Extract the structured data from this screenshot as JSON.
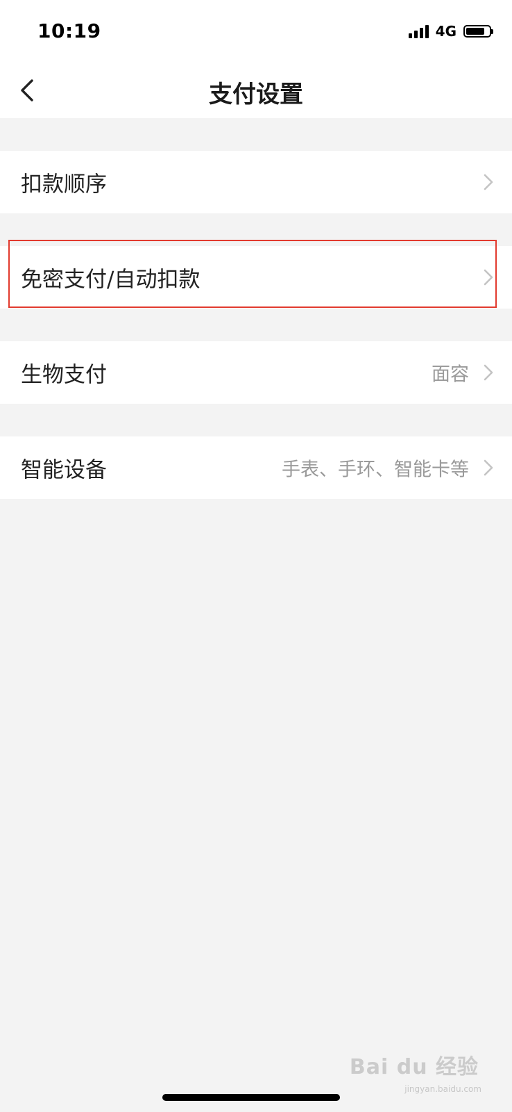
{
  "status_bar": {
    "time": "10:19",
    "network": "4G",
    "battery_level": 0.8
  },
  "nav": {
    "title": "支付设置",
    "back_icon": "chevron-left-icon"
  },
  "settings": {
    "items": [
      {
        "label": "扣款顺序",
        "value": ""
      },
      {
        "label": "免密支付/自动扣款",
        "value": ""
      },
      {
        "label": "生物支付",
        "value": "面容"
      },
      {
        "label": "智能设备",
        "value": "手表、手环、智能卡等"
      }
    ]
  },
  "colors": {
    "page_background": "#f3f3f3",
    "card_background": "#ffffff",
    "highlight_border": "#e23a2e",
    "secondary_text": "#9a9a9a"
  },
  "watermark": {
    "text": "Bai du 经验",
    "subtext": "jingyan.baidu.com"
  }
}
